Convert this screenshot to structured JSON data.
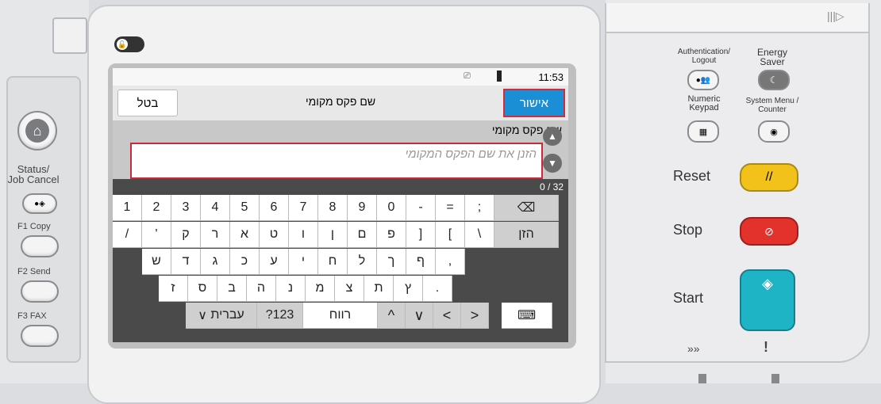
{
  "left": {
    "status_label": "Status/\nJob Cancel",
    "copy_label": "Copy",
    "copy_key": "F1",
    "send_label": "Send",
    "send_key": "F2",
    "fax_label": "FAX",
    "fax_key": "F3"
  },
  "screen": {
    "time": "11:53",
    "title": "שם פקס מקומי",
    "cancel_label": "בטל",
    "ok_label": "אישור",
    "field_label": "שם פקס מקומי",
    "field_placeholder": "הזנן את שם הפקס המקומי",
    "field_value": "",
    "counter": "0 / 32"
  },
  "keyboard": {
    "row1": [
      "1",
      "2",
      "3",
      "4",
      "5",
      "6",
      "7",
      "8",
      "9",
      "0",
      "-",
      "=",
      ";"
    ],
    "row2": [
      "/",
      "'",
      "ק",
      "ר",
      "א",
      "ט",
      "ו",
      "ן",
      "ם",
      "פ",
      "]",
      "[",
      "\\"
    ],
    "enter_label": "הזן",
    "row3": [
      "ש",
      "ד",
      "ג",
      "כ",
      "ע",
      "י",
      "ח",
      "ל",
      "ך",
      "ף",
      ","
    ],
    "row4": [
      "ז",
      "ס",
      "ב",
      "ה",
      "נ",
      "מ",
      "צ",
      "ת",
      "ץ",
      "."
    ],
    "lang_label": "עברית",
    "numsym_label": "?123",
    "space_label": "רווח"
  },
  "right": {
    "auth_label": "Authentication/\nLogout",
    "energy_label": "Energy\nSaver",
    "numeric_label": "Numeric\nKeypad",
    "system_label": "System Menu /\nCounter",
    "reset_label": "Reset",
    "stop_label": "Stop",
    "start_label": "Start",
    "colors": {
      "reset": "#f2c21b",
      "stop": "#e2322b",
      "start": "#1fb3c6",
      "ok": "#1a8fd6",
      "alert": "#c82a3b"
    }
  }
}
